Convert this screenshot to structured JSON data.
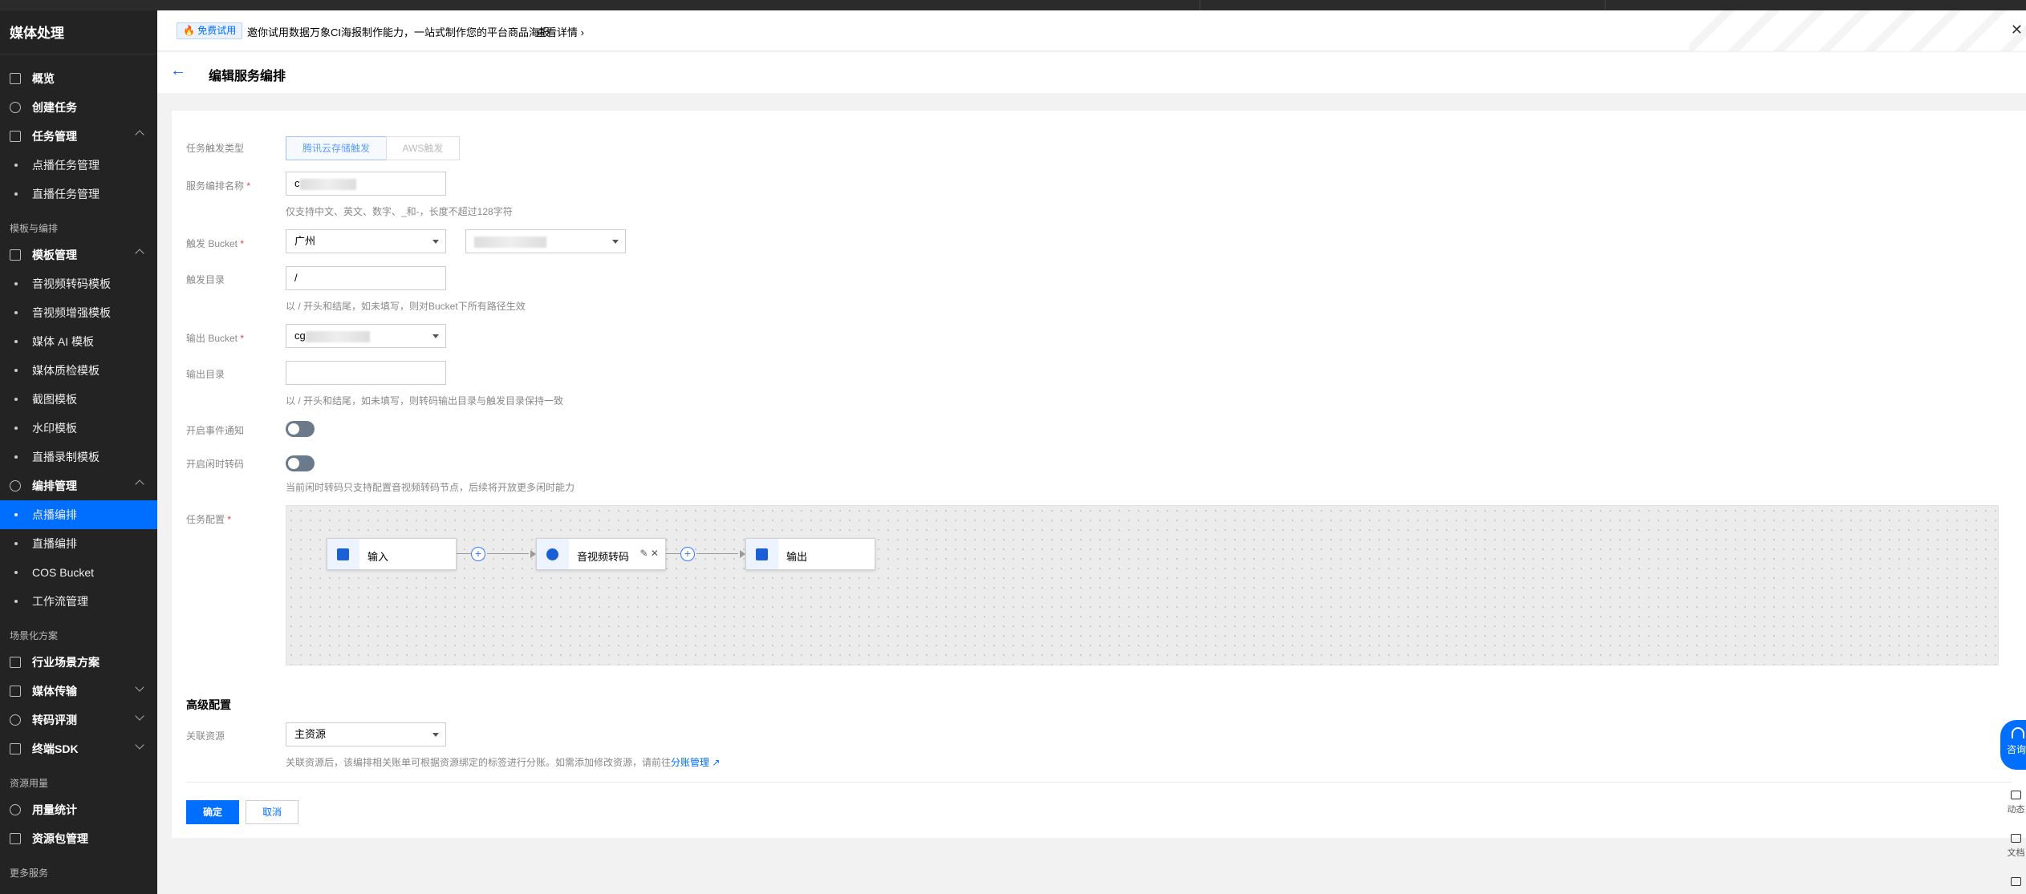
{
  "sidebar": {
    "title": "媒体处理",
    "items": [
      {
        "label": "概览"
      },
      {
        "label": "创建任务"
      },
      {
        "label": "任务管理"
      },
      {
        "label": "点播任务管理"
      },
      {
        "label": "直播任务管理"
      },
      {
        "section": "模板与编排"
      },
      {
        "label": "模板管理"
      },
      {
        "label": "音视频转码模板"
      },
      {
        "label": "音视频增强模板"
      },
      {
        "label": "媒体 AI 模板"
      },
      {
        "label": "媒体质检模板"
      },
      {
        "label": "截图模板"
      },
      {
        "label": "水印模板"
      },
      {
        "label": "直播录制模板"
      },
      {
        "label": "编排管理"
      },
      {
        "label": "点播编排"
      },
      {
        "label": "直播编排"
      },
      {
        "label": "COS Bucket"
      },
      {
        "label": "工作流管理"
      },
      {
        "section": "场景化方案"
      },
      {
        "label": "行业场景方案"
      },
      {
        "label": "媒体传输"
      },
      {
        "label": "转码评测"
      },
      {
        "label": "终端SDK"
      },
      {
        "section": "资源用量"
      },
      {
        "label": "用量统计"
      },
      {
        "label": "资源包管理"
      },
      {
        "section": "更多服务"
      }
    ]
  },
  "notice": {
    "tag": "免费试用",
    "text": "邀你试用数据万象CI海报制作能力，一站式制作您的平台商品海报",
    "more": "查看详情"
  },
  "header": {
    "title": "编辑服务编排"
  },
  "form": {
    "trigger_type_label": "任务触发类型",
    "trigger_options": [
      "腾讯云存储触发",
      "AWS触发"
    ],
    "name_label": "服务编排名称",
    "name_hint": "仅支持中文、英文、数字、_和-，长度不超过128字符",
    "bucket_label": "触发 Bucket",
    "bucket_region": "广州",
    "dir_label": "触发目录",
    "dir_value": "/",
    "dir_hint": "以 / 开头和结尾，如未填写，则对Bucket下所有路径生效",
    "out_bucket_label": "输出 Bucket",
    "out_bucket_value": "cg",
    "out_dir_label": "输出目录",
    "out_dir_hint": "以 / 开头和结尾，如未填写，则转码输出目录与触发目录保持一致",
    "event_label": "开启事件通知",
    "idle_label": "开启闲时转码",
    "idle_hint": "当前闲时转码只支持配置音视频转码节点，后续将开放更多闲时能力",
    "task_label": "任务配置",
    "nodes": [
      "输入",
      "音视频转码",
      "输出"
    ],
    "node_actions": "✎ ✕"
  },
  "advanced": {
    "title": "高级配置",
    "resource_label": "关联资源",
    "resource_value": "主资源",
    "resource_hint": "关联资源后，该编排相关账单可根据资源绑定的标签进行分账。如需添加修改资源，请前往",
    "resource_link": "分账管理"
  },
  "actions": {
    "confirm": "确定",
    "cancel": "取消"
  },
  "float": {
    "consult": "咨询",
    "dynamic": "动态",
    "docs": "文档"
  }
}
